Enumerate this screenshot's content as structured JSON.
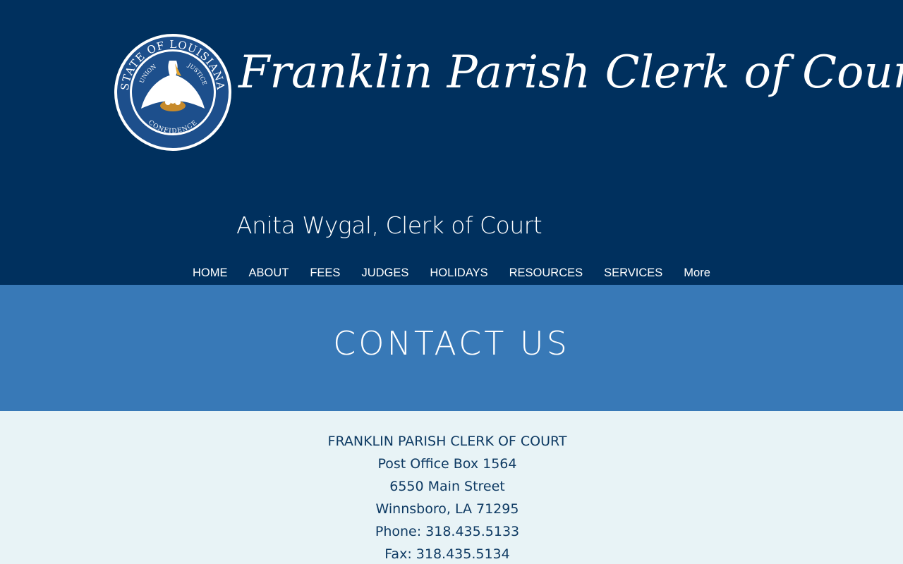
{
  "header": {
    "title": "Franklin Parish Clerk of Court",
    "subtitle": "Anita Wygal, Clerk of Court",
    "seal": {
      "icon": "state-seal-icon",
      "top_text": "STATE OF LOUISIANA",
      "motto_left": "UNION",
      "motto_right": "JUSTICE",
      "bottom_text": "CONFIDENCE"
    }
  },
  "nav": {
    "items": [
      "HOME",
      "ABOUT",
      "FEES",
      "JUDGES",
      "HOLIDAYS",
      "RESOURCES",
      "SERVICES",
      "More"
    ]
  },
  "banner": {
    "title": "CONTACT US"
  },
  "contact": {
    "name": "FRANKLIN PARISH CLERK OF COURT",
    "po_box": "Post Office Box 1564",
    "street": "6550 Main Street",
    "city": "Winnsboro, LA 71295",
    "phone_label": "Phone: ",
    "phone": "318.435.5133",
    "fax_label": "Fax: ",
    "fax": "318.435.5134"
  },
  "colors": {
    "header_bg": "#00305e",
    "banner_bg": "#3879b7",
    "page_bg": "#e8f3f6",
    "contact_text": "#0e3a63"
  }
}
